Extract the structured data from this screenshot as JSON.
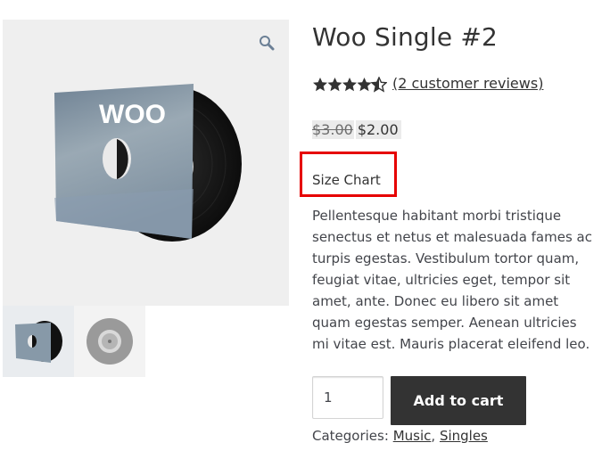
{
  "product": {
    "title": "Woo Single #2",
    "rating": 4.5,
    "rating_max": 5,
    "reviews_link": "(2 customer reviews)",
    "price_old": "$3.00",
    "price_new": "$2.00",
    "size_chart_label": "Size Chart",
    "description": "Pellentesque habitant morbi tristique senectus et netus et malesuada fames ac turpis egestas. Vestibulum tortor quam, feugiat vitae, ultricies eget, tempor sit amet, ante. Donec eu libero sit amet quam egestas semper. Aenean ultricies mi vitae est. Mauris placerat eleifend leo."
  },
  "gallery": {
    "cover_text": "WOO",
    "zoom_icon": "magnifier-icon",
    "thumbnails": [
      "vinyl-sleeve-thumbnail",
      "vinyl-record-thumbnail"
    ]
  },
  "cart": {
    "quantity": "1",
    "add_to_cart_label": "Add to cart"
  },
  "meta": {
    "categories_label": "Categories:",
    "categories": [
      "Music",
      "Singles"
    ],
    "separator": ","
  },
  "colors": {
    "highlight_border": "#e60000",
    "button_bg": "#333333",
    "star": "#333333"
  }
}
